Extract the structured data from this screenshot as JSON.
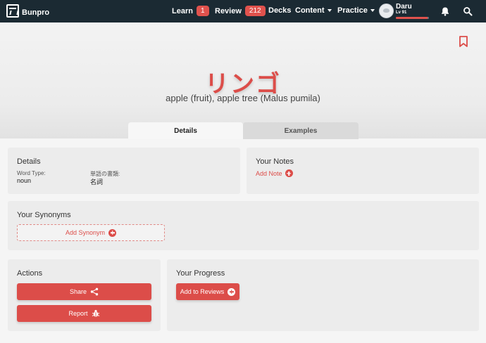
{
  "nav": {
    "brand": "Bunpro",
    "learn_label": "Learn",
    "learn_count": "1",
    "review_label": "Review",
    "review_count": "212",
    "decks_label": "Decks",
    "content_label": "Content",
    "practice_label": "Practice",
    "user_name": "Daru",
    "user_level": "Lv 91",
    "xp_progress_percent": 95,
    "icons": [
      "bunpro-logo-icon",
      "chevron-down-icon",
      "user-avatar",
      "bell-icon",
      "search-icon"
    ]
  },
  "hero": {
    "word": "リンゴ",
    "meaning": "apple (fruit), apple tree (Malus pumila)",
    "bookmark_icon": "bookmark-icon"
  },
  "tabs": [
    {
      "label": "Details",
      "active": true
    },
    {
      "label": "Examples",
      "active": false
    }
  ],
  "details": {
    "title": "Details",
    "word_type_label": "Word Type:",
    "word_type_value": "noun",
    "jp_type_label": "単語の書類:",
    "jp_type_value": "名詞"
  },
  "notes": {
    "title": "Your Notes",
    "add_label": "Add Note"
  },
  "synonyms": {
    "title": "Your Synonyms",
    "add_label": "Add Synonym"
  },
  "actions": {
    "title": "Actions",
    "share_label": "Share",
    "report_label": "Report"
  },
  "progress": {
    "title": "Your Progress",
    "add_label": "Add to Reviews"
  },
  "colors": {
    "accent": "#dc4d49",
    "navbar": "#1b2a33",
    "card": "#ececec"
  }
}
